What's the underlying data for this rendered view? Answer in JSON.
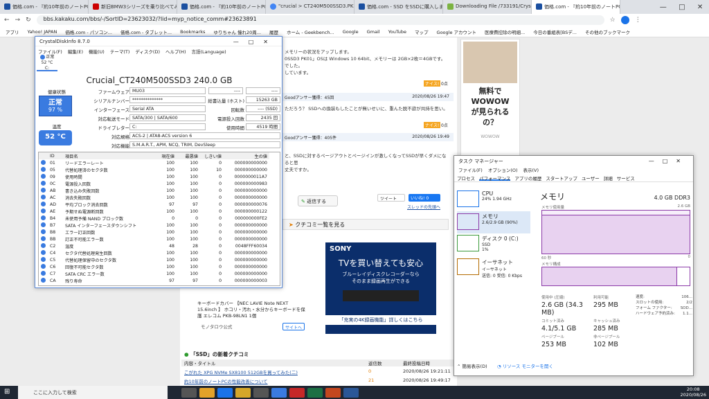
{
  "tabs": [
    {
      "label": "価格.com - 『約10年前のノートPCか"
    },
    {
      "label": "新旧BMW3シリーズを乗り比べてみた"
    },
    {
      "label": "価格.com - 『約10年前のノートPCか"
    },
    {
      "label": "\"crucial > CT240M500SSD3.PKii"
    },
    {
      "label": "価格.com - SSD をSSDに購入しま"
    },
    {
      "label": "Downloading File /733191/Crystal"
    },
    {
      "label": "価格.com - 『約10年前のノートPCか"
    }
  ],
  "address": {
    "url": "bbs.kakaku.com/bbs/-/SortID=23623032/?lid=myp_notice_comm#23623891"
  },
  "bookmarks": [
    "アプリ",
    "Yahoo! JAPAN",
    "価格.com - パソコン...",
    "価格.com - タブレット...",
    "Bookmarks",
    "ゆりちゃん 憧れ20周...",
    "履歴",
    "ホーム - Geekbench...",
    "Google",
    "Gmail",
    "YouTube",
    "マップ",
    "Google アカウント",
    "医療費控除の明細...",
    "今日の番組表[BSデ...",
    "その他のブックマーク"
  ],
  "page": {
    "post1": "メモリーの状況をアップします。",
    "post2": "0SSD3 PK01」OSは Windows 10 64bit、メモリーは 2GB×2枚＝4GBです。",
    "post3": "でした。",
    "post4": "しています。",
    "nice": "ナイス!",
    "nice_count": "0点",
    "answer_header": "Goodアンサー獲得：45回",
    "date1": "2020/08/26 19:47",
    "post5": "ただろう？ SSDへの換装もしたことが無いせいに、重んた脱不欲が共持を思い。",
    "answer_header2": "Goodアンサー獲得：405件",
    "date2": "2020/08/26 19:49",
    "post6": "と、SSDに対するページアウトとページインが激しくなってSSDが早くダメになると思",
    "post7": "丈夫ですか。",
    "reply_btn": "返信する",
    "tweet": "ツイート",
    "like": "いいね! 0",
    "thread_link": "スレッドの先頭へ",
    "kuchikomi_btn": "クチコミ一覧を見る",
    "ad_sony_brand": "SONY",
    "ad_sony_title": "TVを買い替えても安心",
    "ad_sony_line1": "ブルーレイディスクレコーダーなら",
    "ad_sony_line2": "そのまま録画再生ができる",
    "ad_sony_footer": "「充実の4K録画機能」詳しくはこちら",
    "ad_product": "キーボードカバー 【NEC LAVIE Note NEXT 15.6inch 】 ホコリ・汚れ・水分からキーボードを保護 エレコム PKB-98LN1 1個",
    "ad_shop": "モノタロウ公式",
    "ad_site_btn": "サイトへ",
    "wowow_line1": "無料で",
    "wowow_line2": "WOWOW",
    "wowow_line3": "が見られる",
    "wowow_line4": "の？",
    "wowow_logo": "WOWOW",
    "ssd_section_title": "「SSD」の新着クチコミ",
    "list_headers": [
      "内容・タイトル",
      "返信数",
      "最終投稿日時"
    ],
    "list_rows": [
      {
        "title": "こがれた XPG NVMe SX8100 512GBを買ってみた(二)",
        "replies": "0",
        "date": "2020/08/26 19:21:11"
      },
      {
        "title": "約10年前のノートPCの性能改善について",
        "replies": "21",
        "date": "2020/08/26 19:49:17"
      }
    ]
  },
  "cdi": {
    "window_title": "CrystalDiskInfo 8.7.0",
    "menu": [
      "ファイル(F)",
      "編集(E)",
      "機能(U)",
      "テーマ(T)",
      "ディスク(D)",
      "ヘルプ(H)",
      "言語(Language)"
    ],
    "drive_status": "正常",
    "drive_temp": "52 °C",
    "drive_letter": "C:",
    "model": "Crucial_CT240M500SSD3 240.0 GB",
    "health_label": "健康状態",
    "health_status": "正常",
    "health_pct": "97 %",
    "temp_label": "温度",
    "temp": "52 °C",
    "firmware_label": "ファームウェア",
    "firmware": "MU03",
    "serial_label": "シリアルナンバー",
    "serial": "**************",
    "interface_label": "インターフェース",
    "interface": "Serial ATA",
    "transfer_label": "対応転送モード",
    "transfer": "SATA/300 | SATA/600",
    "driveletter_label": "ドライブレター",
    "driveletter": "C:",
    "standard_label": "対応規格",
    "standard": "ACS-2 | ATA8-ACS version 6",
    "features_label": "対応機能",
    "features": "S.M.A.R.T., APM, NCQ, TRIM, DevSleep",
    "dash1": "----",
    "dash2": "----",
    "hostwrite_label": "総書込量 (ホスト)",
    "hostwrite": "15263 GB",
    "rpm_label": "回転数",
    "rpm": "---- (SSD)",
    "poweron_label": "電源投入回数",
    "poweron": "2435 回",
    "hours_label": "使用時間",
    "hours": "4519 時間",
    "table_headers": [
      "ID",
      "項目名",
      "現在値",
      "最悪値",
      "しきい値",
      "生の値"
    ],
    "rows": [
      {
        "id": "01",
        "name": "リードエラーレート",
        "cur": "100",
        "worst": "100",
        "thr": "0",
        "raw": "000000000000"
      },
      {
        "id": "05",
        "name": "代替処理済のセクタ数",
        "cur": "100",
        "worst": "100",
        "thr": "10",
        "raw": "000000000000"
      },
      {
        "id": "09",
        "name": "使用時間",
        "cur": "100",
        "worst": "100",
        "thr": "0",
        "raw": "0000000011A7"
      },
      {
        "id": "0C",
        "name": "電源投入回数",
        "cur": "100",
        "worst": "100",
        "thr": "0",
        "raw": "000000000983"
      },
      {
        "id": "AB",
        "name": "書き込み失敗回数",
        "cur": "100",
        "worst": "100",
        "thr": "0",
        "raw": "000000000000"
      },
      {
        "id": "AC",
        "name": "消去失敗回数",
        "cur": "100",
        "worst": "100",
        "thr": "0",
        "raw": "000000000000"
      },
      {
        "id": "AD",
        "name": "平均ブロック消去回数",
        "cur": "97",
        "worst": "97",
        "thr": "0",
        "raw": "000000000076"
      },
      {
        "id": "AE",
        "name": "予期せぬ電源断回数",
        "cur": "100",
        "worst": "100",
        "thr": "0",
        "raw": "000000000122"
      },
      {
        "id": "B4",
        "name": "未使用予備 NAND ブロック数",
        "cur": "0",
        "worst": "0",
        "thr": "0",
        "raw": "000000000FE2"
      },
      {
        "id": "B7",
        "name": "SATA インターフェースダウンシフト",
        "cur": "100",
        "worst": "100",
        "thr": "0",
        "raw": "000000000000"
      },
      {
        "id": "B8",
        "name": "エラー訂正回数",
        "cur": "100",
        "worst": "100",
        "thr": "0",
        "raw": "000000000000"
      },
      {
        "id": "BB",
        "name": "訂正不可能エラー数",
        "cur": "100",
        "worst": "100",
        "thr": "0",
        "raw": "000000000000"
      },
      {
        "id": "C2",
        "name": "温度",
        "cur": "48",
        "worst": "28",
        "thr": "0",
        "raw": "0048FFF60034"
      },
      {
        "id": "C4",
        "name": "セクタ代替処理発生回数",
        "cur": "100",
        "worst": "100",
        "thr": "0",
        "raw": "000000000000"
      },
      {
        "id": "C5",
        "name": "代替処理保留中のセクタ数",
        "cur": "100",
        "worst": "100",
        "thr": "0",
        "raw": "000000000000"
      },
      {
        "id": "C6",
        "name": "回復不可能セクタ数",
        "cur": "100",
        "worst": "100",
        "thr": "0",
        "raw": "000000000000"
      },
      {
        "id": "C7",
        "name": "SATA CRC エラー数",
        "cur": "100",
        "worst": "100",
        "thr": "0",
        "raw": "000000000000"
      },
      {
        "id": "CA",
        "name": "残り寿命",
        "cur": "97",
        "worst": "97",
        "thr": "0",
        "raw": "000000000003"
      }
    ]
  },
  "tm": {
    "title": "タスク マネージャー",
    "menu": [
      "ファイル(F)",
      "オプション(O)",
      "表示(V)"
    ],
    "tabs": [
      "プロセス",
      "パフォーマンス",
      "アプリの履歴",
      "スタートアップ",
      "ユーザー",
      "詳細",
      "サービス"
    ],
    "side": [
      {
        "name": "CPU",
        "sub": "24%  1.94 GHz"
      },
      {
        "name": "メモリ",
        "sub": "2.6/2.9 GB (90%)"
      },
      {
        "name": "ディスク 0 (C:)",
        "sub": "SSD",
        "sub2": "1%"
      },
      {
        "name": "イーサネット",
        "sub": "イーサネット",
        "sub2": "送信: 0 受信: 0 Kbps"
      }
    ],
    "main_title": "メモリ",
    "main_cap": "4.0 GB DDR3",
    "usage_label": "メモリ使用量",
    "usage_max": "2.6 GB",
    "sec_label": "60 秒",
    "zero": "0",
    "comp_label": "メモリ構成",
    "stats": [
      {
        "label": "使用中 (圧縮)",
        "value": "2.6 GB (34.3 MB)"
      },
      {
        "label": "利用可能",
        "value": "295 MB"
      },
      {
        "label": "コミット済み",
        "value": "4.1/5.1 GB"
      },
      {
        "label": "キャッシュ済み",
        "value": "285 MB"
      },
      {
        "label": "ページプール",
        "value": "253 MB"
      },
      {
        "label": "非ページプール",
        "value": "102 MB"
      }
    ],
    "right": [
      {
        "label": "速度:",
        "value": "106..."
      },
      {
        "label": "スロットの使用:",
        "value": "2/2"
      },
      {
        "label": "フォーム ファクター:",
        "value": "SOD..."
      },
      {
        "label": "ハードウェア予約済み:",
        "value": "1.1..."
      }
    ],
    "brief": "簡易表示(D)",
    "monitor": "リソース モニターを開く"
  },
  "taskbar": {
    "search": "ここに入力して検索",
    "time": "20:08",
    "date": "2020/08/26"
  }
}
